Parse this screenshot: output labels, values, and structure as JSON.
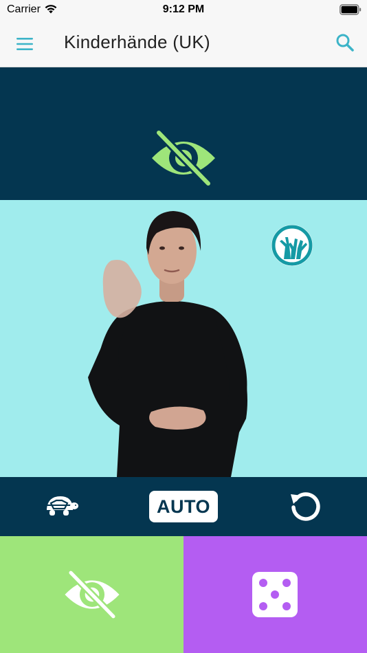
{
  "status_bar": {
    "carrier": "Carrier",
    "time": "9:12 PM",
    "icons": [
      "wifi-icon",
      "battery-icon"
    ]
  },
  "nav_bar": {
    "title": "Kinderhände (UK)",
    "left_icon": "menu-icon",
    "right_icon": "search-icon"
  },
  "hidden_panel": {
    "icon": "eye-off-icon"
  },
  "video": {
    "logo_icon": "kinderhaende-logo-icon"
  },
  "controls": {
    "speed_icon": "turtle-icon",
    "auto_label": "AUTO",
    "replay_icon": "replay-icon"
  },
  "bottom": {
    "reveal_icon": "eye-off-icon",
    "random_icon": "dice-icon"
  },
  "colors": {
    "dark_navy": "#043650",
    "video_bg": "#a0eced",
    "accent_green": "#9ee57a",
    "accent_purple": "#b45df2",
    "accent_cyan": "#3cb4c8",
    "logo_teal": "#159aa5"
  }
}
